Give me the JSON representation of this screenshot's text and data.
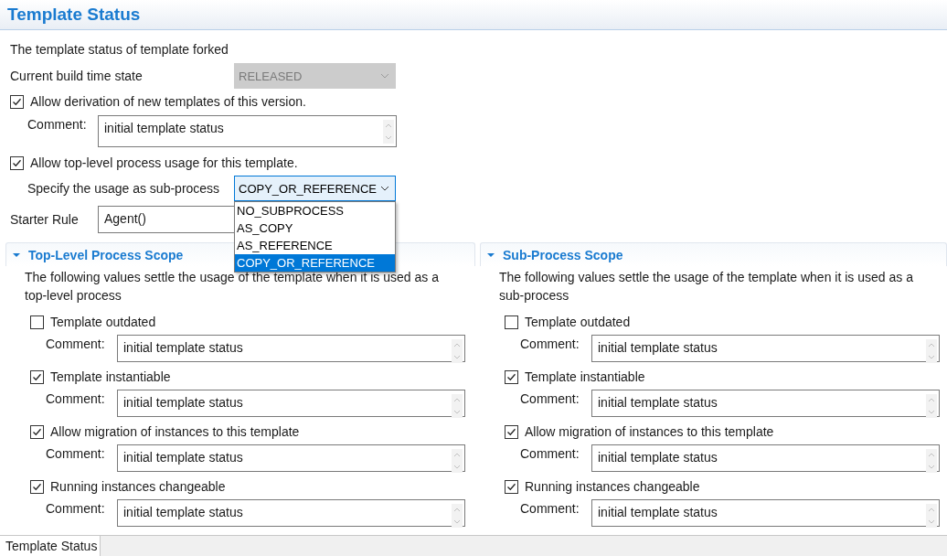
{
  "header": {
    "title": "Template Status"
  },
  "intro": "The template status of template forked",
  "build_time_state": {
    "label": "Current build time state",
    "value": "RELEASED",
    "disabled": true
  },
  "allow_derivation": {
    "label": "Allow derivation of new templates of this version.",
    "checked": true,
    "comment_label": "Comment:",
    "comment": "initial template status"
  },
  "allow_top_level": {
    "label": "Allow top-level process usage for this template.",
    "checked": true
  },
  "subprocess_usage": {
    "label": "Specify the usage as sub-process",
    "value": "COPY_OR_REFERENCE",
    "expanded": true,
    "options": [
      {
        "label": "NO_SUBPROCESS",
        "selected": false
      },
      {
        "label": "AS_COPY",
        "selected": false
      },
      {
        "label": "AS_REFERENCE",
        "selected": false
      },
      {
        "label": "COPY_OR_REFERENCE",
        "selected": true
      }
    ]
  },
  "starter_rule": {
    "label": "Starter Rule",
    "value": "Agent()"
  },
  "scopes": [
    {
      "title": "Top-Level Process Scope",
      "expanded": true,
      "description": "The following values settle the usage of the template when it is used as a top-level process",
      "items": [
        {
          "label": "Template outdated",
          "checked": false,
          "comment_label": "Comment:",
          "comment": "initial template status"
        },
        {
          "label": "Template instantiable",
          "checked": true,
          "comment_label": "Comment:",
          "comment": "initial template status"
        },
        {
          "label": "Allow migration of instances to this template",
          "checked": true,
          "comment_label": "Comment:",
          "comment": "initial template status"
        },
        {
          "label": "Running instances changeable",
          "checked": true,
          "comment_label": "Comment:",
          "comment": "initial template status"
        }
      ]
    },
    {
      "title": "Sub-Process Scope",
      "expanded": true,
      "description": "The following values settle the usage of the template when it is used as a sub-process",
      "items": [
        {
          "label": "Template outdated",
          "checked": false,
          "comment_label": "Comment:",
          "comment": "initial template status"
        },
        {
          "label": "Template instantiable",
          "checked": true,
          "comment_label": "Comment:",
          "comment": "initial template status"
        },
        {
          "label": "Allow migration of instances to this template",
          "checked": true,
          "comment_label": "Comment:",
          "comment": "initial template status"
        },
        {
          "label": "Running instances changeable",
          "checked": true,
          "comment_label": "Comment:",
          "comment": "initial template status"
        }
      ]
    }
  ],
  "status_tab": {
    "label": "Template Status"
  }
}
